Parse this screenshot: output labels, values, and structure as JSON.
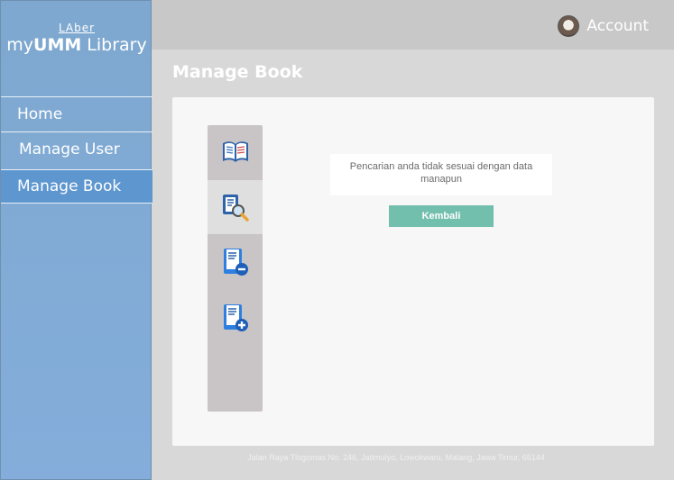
{
  "logo": {
    "small": "LAber",
    "prefix": "my",
    "bold": "UMM",
    "suffix": " Library"
  },
  "nav": {
    "items": [
      {
        "label": "Home"
      },
      {
        "label": "Manage User"
      },
      {
        "label": "Manage Book"
      }
    ],
    "active": "Manage Book"
  },
  "header": {
    "account_label": "Account"
  },
  "page": {
    "title": "Manage Book"
  },
  "tools": [
    {
      "icon": "open-book-icon",
      "active": false
    },
    {
      "icon": "search-book-icon",
      "active": true
    },
    {
      "icon": "remove-book-icon",
      "active": false
    },
    {
      "icon": "add-book-icon",
      "active": false
    }
  ],
  "result": {
    "message": "Pencarian anda tidak sesuai dengan data manapun",
    "back_label": "Kembali"
  },
  "footer": {
    "address": "Jalan Raya Tlogomas No. 246, Jatimulyo, Lowokwaru, Malang, Jawa Timur, 65144"
  },
  "colors": {
    "sidebar": "#84addb",
    "active_nav": "#5e96cf",
    "button": "#73bfae",
    "topbar": "#c8c8c8"
  }
}
